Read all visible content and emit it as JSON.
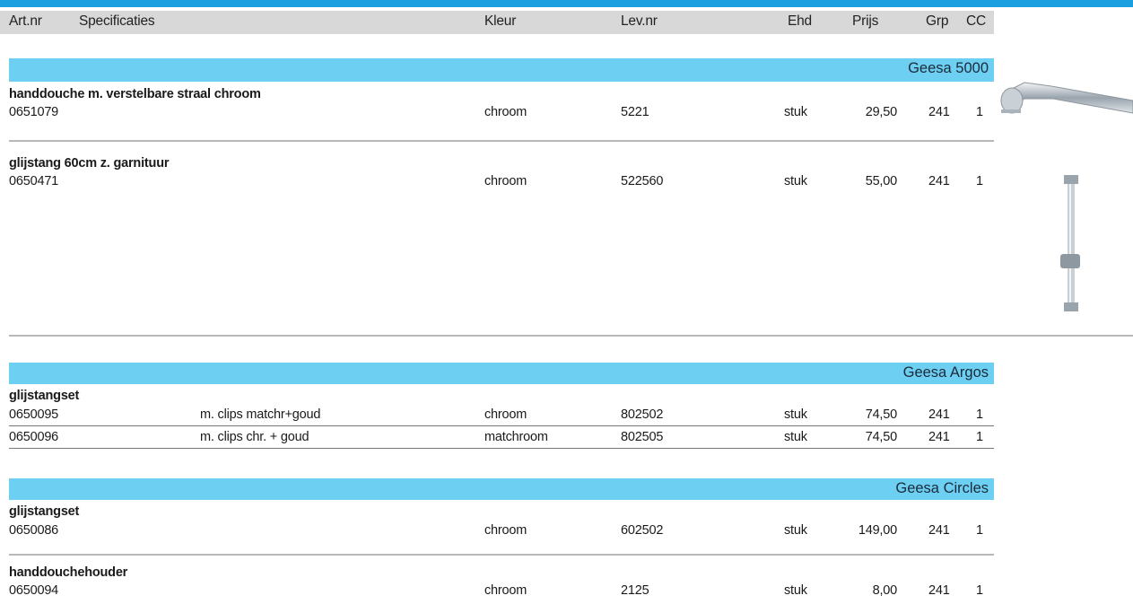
{
  "header": {
    "artnr": "Art.nr",
    "spec": "Specificaties",
    "kleur": "Kleur",
    "levnr": "Lev.nr",
    "ehd": "Ehd",
    "prijs": "Prijs",
    "grp": "Grp",
    "cc": "CC"
  },
  "sections": [
    {
      "title": "Geesa 5000",
      "items": [
        {
          "name": "handdouche m. verstelbare straal chroom",
          "artnr": "0651079",
          "spec": "",
          "kleur": "chroom",
          "levnr": "5221",
          "ehd": "stuk",
          "prijs": "29,50",
          "grp": "241",
          "cc": "1"
        },
        {
          "name": "glijstang 60cm z. garnituur",
          "artnr": "0650471",
          "spec": "",
          "kleur": "chroom",
          "levnr": "522560",
          "ehd": "stuk",
          "prijs": "55,00",
          "grp": "241",
          "cc": "1"
        }
      ]
    },
    {
      "title": "Geesa Argos",
      "items": [
        {
          "name": "glijstangset",
          "artnr": "0650095",
          "spec": "m. clips matchr+goud",
          "kleur": "chroom",
          "levnr": "802502",
          "ehd": "stuk",
          "prijs": "74,50",
          "grp": "241",
          "cc": "1"
        },
        {
          "name": "",
          "artnr": "0650096",
          "spec": "m. clips chr. + goud",
          "kleur": "matchroom",
          "levnr": "802505",
          "ehd": "stuk",
          "prijs": "74,50",
          "grp": "241",
          "cc": "1"
        }
      ]
    },
    {
      "title": "Geesa Circles",
      "items": [
        {
          "name": "glijstangset",
          "artnr": "0650086",
          "spec": "",
          "kleur": "chroom",
          "levnr": "602502",
          "ehd": "stuk",
          "prijs": "149,00",
          "grp": "241",
          "cc": "1"
        },
        {
          "name": "handdouchehouder",
          "artnr": "0650094",
          "spec": "",
          "kleur": "chroom",
          "levnr": "2125",
          "ehd": "stuk",
          "prijs": "8,00",
          "grp": "241",
          "cc": "1"
        }
      ]
    }
  ],
  "images": [
    {
      "name": "handshower-product-image"
    },
    {
      "name": "slide-rail-product-image"
    }
  ]
}
